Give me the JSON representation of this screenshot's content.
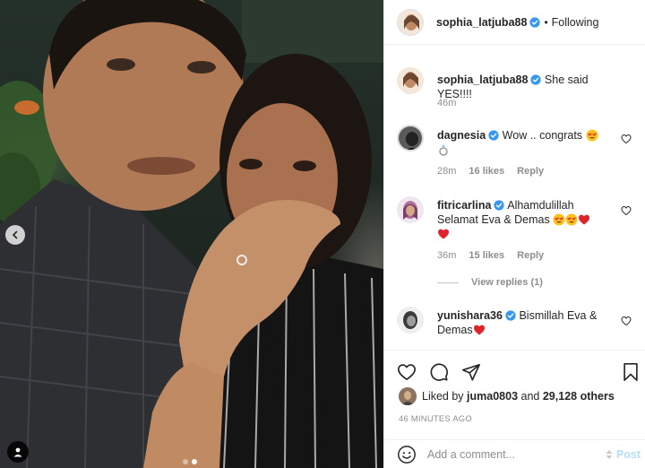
{
  "post": {
    "author": "sophia_latjuba88",
    "follow_status": "Following",
    "separator": "•",
    "caption": "She said YES!!!!",
    "caption_time": "46m"
  },
  "comments": [
    {
      "user": "dagnesia",
      "verified": true,
      "text": "Wow .. congrats",
      "emojis": [
        "heart-eyes",
        "ring"
      ],
      "time": "28m",
      "likes": "16 likes",
      "reply_label": "Reply"
    },
    {
      "user": "fitricarlina",
      "verified": true,
      "text_line1": "Alhamdulillah",
      "text_line2": "Selamat Eva & Demas",
      "emojis": [
        "heart-eyes",
        "heart-eyes",
        "red-heart",
        "red-heart"
      ],
      "time": "36m",
      "likes": "15 likes",
      "reply_label": "Reply",
      "view_replies": "View replies (1)"
    },
    {
      "user": "yunishara36",
      "verified": true,
      "text_line1": "Bismillah Eva &",
      "text_line2": "Demas",
      "emojis": [
        "red-heart"
      ]
    }
  ],
  "liked_by": {
    "prefix": "Liked by",
    "user": "juma0803",
    "and": "and",
    "count": "29,128 others"
  },
  "timestamp": "46 MINUTES AGO",
  "composer": {
    "placeholder": "Add a comment...",
    "post_label": "Post"
  },
  "carousel": {
    "total": 2,
    "current": 2
  },
  "icons": {
    "verified": "verified-badge-icon",
    "like": "heart-icon",
    "comment": "speech-bubble-icon",
    "share": "paper-plane-icon",
    "save": "bookmark-icon",
    "emoji": "smiley-icon",
    "prev": "chevron-left-icon",
    "tags": "user-tag-icon"
  },
  "colors": {
    "verified_blue": "#3897f0",
    "text": "#262626",
    "muted": "#8e8e8e",
    "post_disabled": "#b2dffc",
    "heart_red": "#ed4956"
  }
}
